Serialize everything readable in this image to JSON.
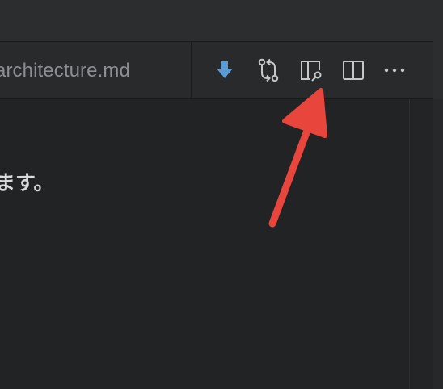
{
  "tab": {
    "title": "architecture.md"
  },
  "toolbar": {
    "buttons": [
      {
        "name": "download-icon",
        "label": ""
      },
      {
        "name": "source-control-compare-icon",
        "label": ""
      },
      {
        "name": "open-preview-icon",
        "label": ""
      },
      {
        "name": "split-editor-icon",
        "label": ""
      },
      {
        "name": "more-actions-icon",
        "label": ""
      }
    ],
    "more_glyph": "···"
  },
  "editor": {
    "visible_text": "ます。"
  },
  "annotation": {
    "arrow_color": "#e8453c",
    "points_to": "open-preview-icon"
  },
  "colors": {
    "background": "#212324",
    "tab_bar": "#282a2b",
    "download_icon": "#5b9bd5",
    "icon_stroke": "#c5c7c9"
  }
}
